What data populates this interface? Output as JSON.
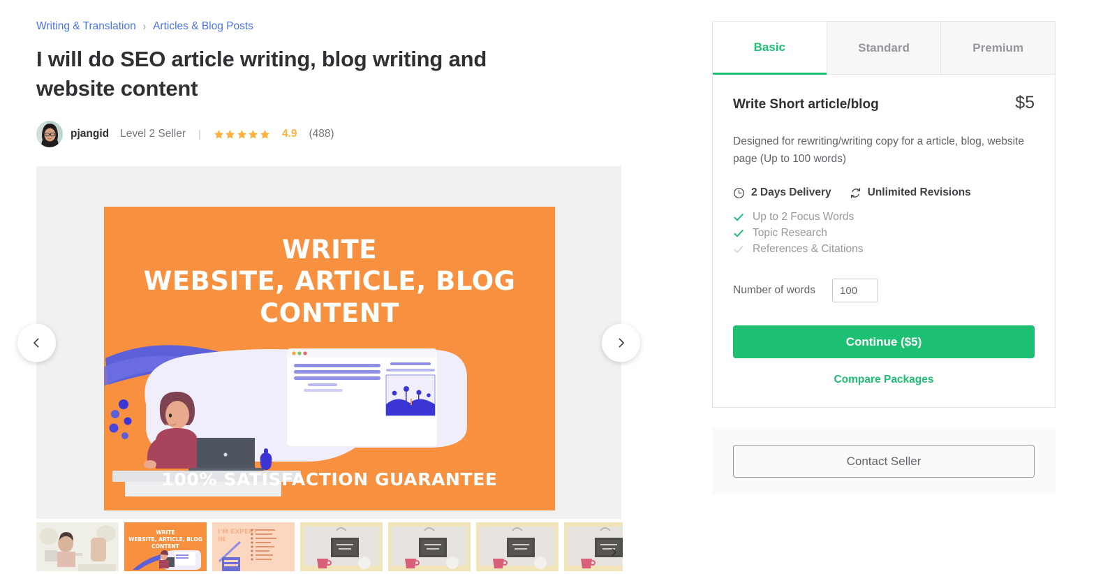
{
  "breadcrumb": {
    "items": [
      {
        "label": "Writing & Translation"
      },
      {
        "label": "Articles & Blog Posts"
      }
    ],
    "separator": "›"
  },
  "gig": {
    "title": "I will do SEO article writing, blog writing and website content"
  },
  "seller": {
    "name": "pjangid",
    "level": "Level 2 Seller",
    "separator": "|",
    "rating": "4.9",
    "reviews_count": "(488)",
    "stars_filled": 5
  },
  "gallery": {
    "prev_label": "‹",
    "next_label": "›",
    "slide": {
      "line1": "WRITE",
      "line2": "WEBSITE, ARTICLE, BLOG",
      "line3": "CONTENT",
      "footer": "100% SATISFACTION GUARANTEE",
      "background_color": "#f7903f"
    },
    "thumbnails": [
      {
        "kind": "photo-desk",
        "selected": false
      },
      {
        "kind": "orange-write-content",
        "selected": true
      },
      {
        "kind": "peach-im-expert",
        "selected": false
      },
      {
        "kind": "chalkboard-mug",
        "selected": false
      },
      {
        "kind": "chalkboard-mug",
        "selected": false
      },
      {
        "kind": "chalkboard-mug",
        "selected": false
      },
      {
        "kind": "chalkboard-mug",
        "selected": false
      }
    ],
    "thumbs_next_label": "›"
  },
  "packages": {
    "tabs": [
      {
        "label": "Basic",
        "active": true
      },
      {
        "label": "Standard",
        "active": false
      },
      {
        "label": "Premium",
        "active": false
      }
    ],
    "active": {
      "name": "Write Short article/blog",
      "price": "$5",
      "description": "Designed for rewriting/writing copy for a article, blog, website page (Up to 100 words)",
      "delivery": "2 Days Delivery",
      "revisions": "Unlimited Revisions",
      "features": [
        {
          "label": "Up to 2 Focus Words",
          "included": true
        },
        {
          "label": "Topic Research",
          "included": true
        },
        {
          "label": "References & Citations",
          "included": false
        }
      ],
      "words_label": "Number of words",
      "words_value": "100",
      "words_placeholder": "100",
      "continue_label": "Continue ($5)",
      "compare_label": "Compare Packages"
    }
  },
  "contact": {
    "button_label": "Contact Seller"
  },
  "colors": {
    "brand_green": "#1dbf73",
    "link_blue": "#4a73e8",
    "star_yellow": "#ffb33e",
    "slide_orange": "#f7903f",
    "text_dark": "#2f3033",
    "text_muted": "#74767e"
  }
}
